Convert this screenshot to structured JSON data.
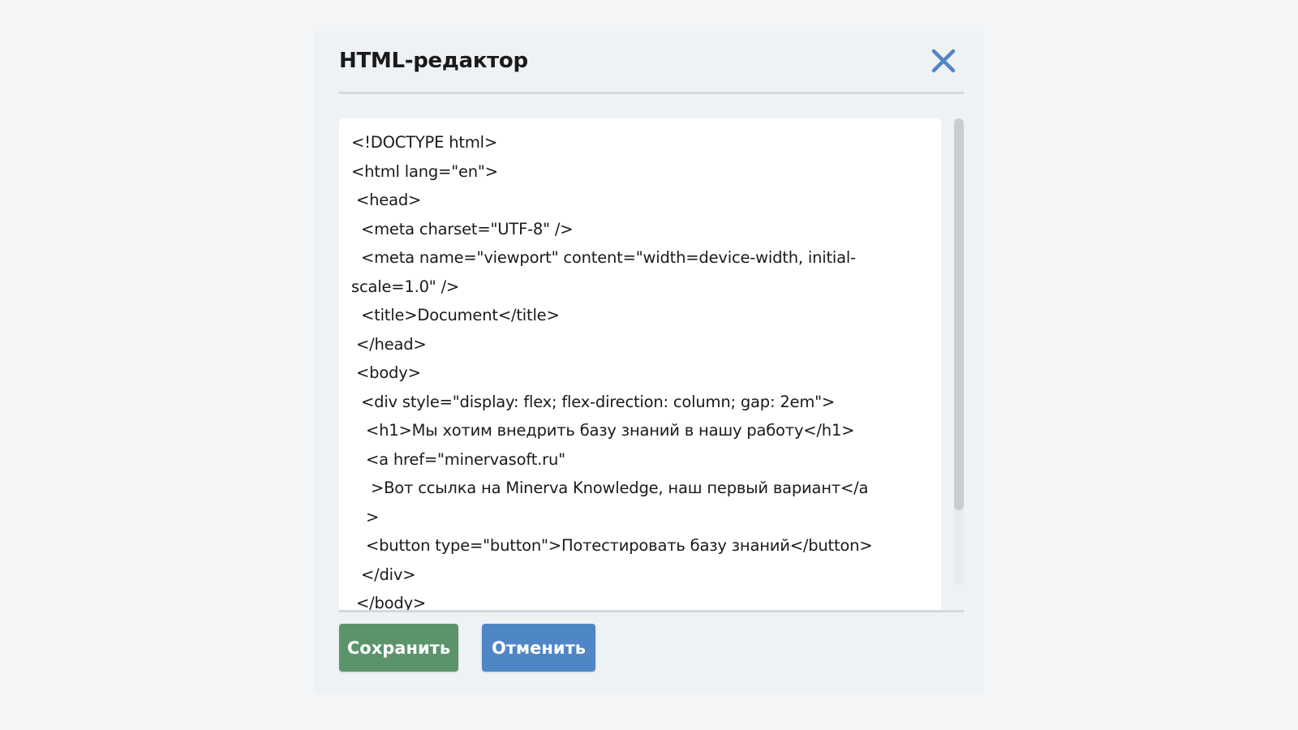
{
  "dialog": {
    "title": "HTML-редактор",
    "close_icon": "close-icon",
    "accent_color": "#4f86c6"
  },
  "editor": {
    "lines": [
      "<!DOCTYPE html>",
      "<html lang=\"en\">",
      " <head>",
      "  <meta charset=\"UTF-8\" />",
      "  <meta name=\"viewport\" content=\"width=device-width, initial-",
      "scale=1.0\" />",
      "  <title>Document</title>",
      " </head>",
      " <body>",
      "  <div style=\"display: flex; flex-direction: column; gap: 2em\">",
      "   <h1>Мы хотим внедрить базу знаний в нашу работу</h1>",
      "   <a href=\"minervasoft.ru\"",
      "    >Вот ссылка на Minerva Knowledge, наш первый вариант</a",
      "   >",
      "   <button type=\"button\">Потестировать базу знаний</button>",
      "  </div>",
      " </body>"
    ]
  },
  "footer": {
    "save_label": "Сохранить",
    "save_color": "#5b946b",
    "cancel_label": "Отменить",
    "cancel_color": "#4f86c6"
  }
}
